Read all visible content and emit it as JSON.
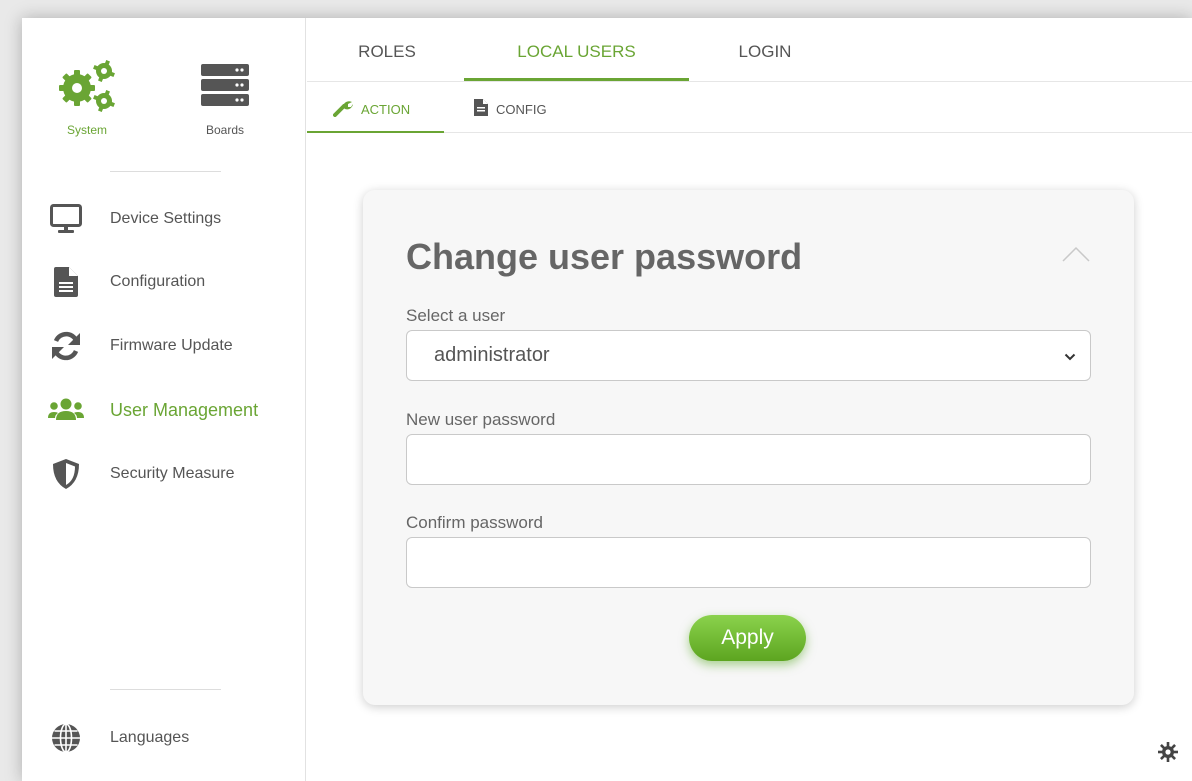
{
  "sidebar": {
    "top": [
      {
        "label": "System",
        "icon": "gears-icon"
      },
      {
        "label": "Boards",
        "icon": "server-icon"
      }
    ],
    "items": [
      {
        "label": "Device Settings",
        "icon": "monitor-icon"
      },
      {
        "label": "Configuration",
        "icon": "file-icon"
      },
      {
        "label": "Firmware Update",
        "icon": "sync-icon"
      },
      {
        "label": "User Management",
        "icon": "users-icon",
        "active": true
      },
      {
        "label": "Security Measure",
        "icon": "shield-icon"
      }
    ],
    "languages": {
      "label": "Languages",
      "icon": "globe-icon"
    }
  },
  "tabs": [
    {
      "label": "ROLES"
    },
    {
      "label": "LOCAL USERS",
      "active": true
    },
    {
      "label": "LOGIN"
    }
  ],
  "subtabs": [
    {
      "label": "ACTION",
      "icon": "wrench-icon",
      "active": true
    },
    {
      "label": "CONFIG",
      "icon": "document-icon"
    }
  ],
  "card": {
    "title": "Change user password",
    "select_label": "Select a user",
    "selected_user": "administrator",
    "new_password_label": "New user password",
    "new_password_value": "",
    "confirm_label": "Confirm password",
    "confirm_value": "",
    "apply_label": "Apply"
  },
  "colors": {
    "accent": "#6aa534",
    "text": "#555555"
  }
}
